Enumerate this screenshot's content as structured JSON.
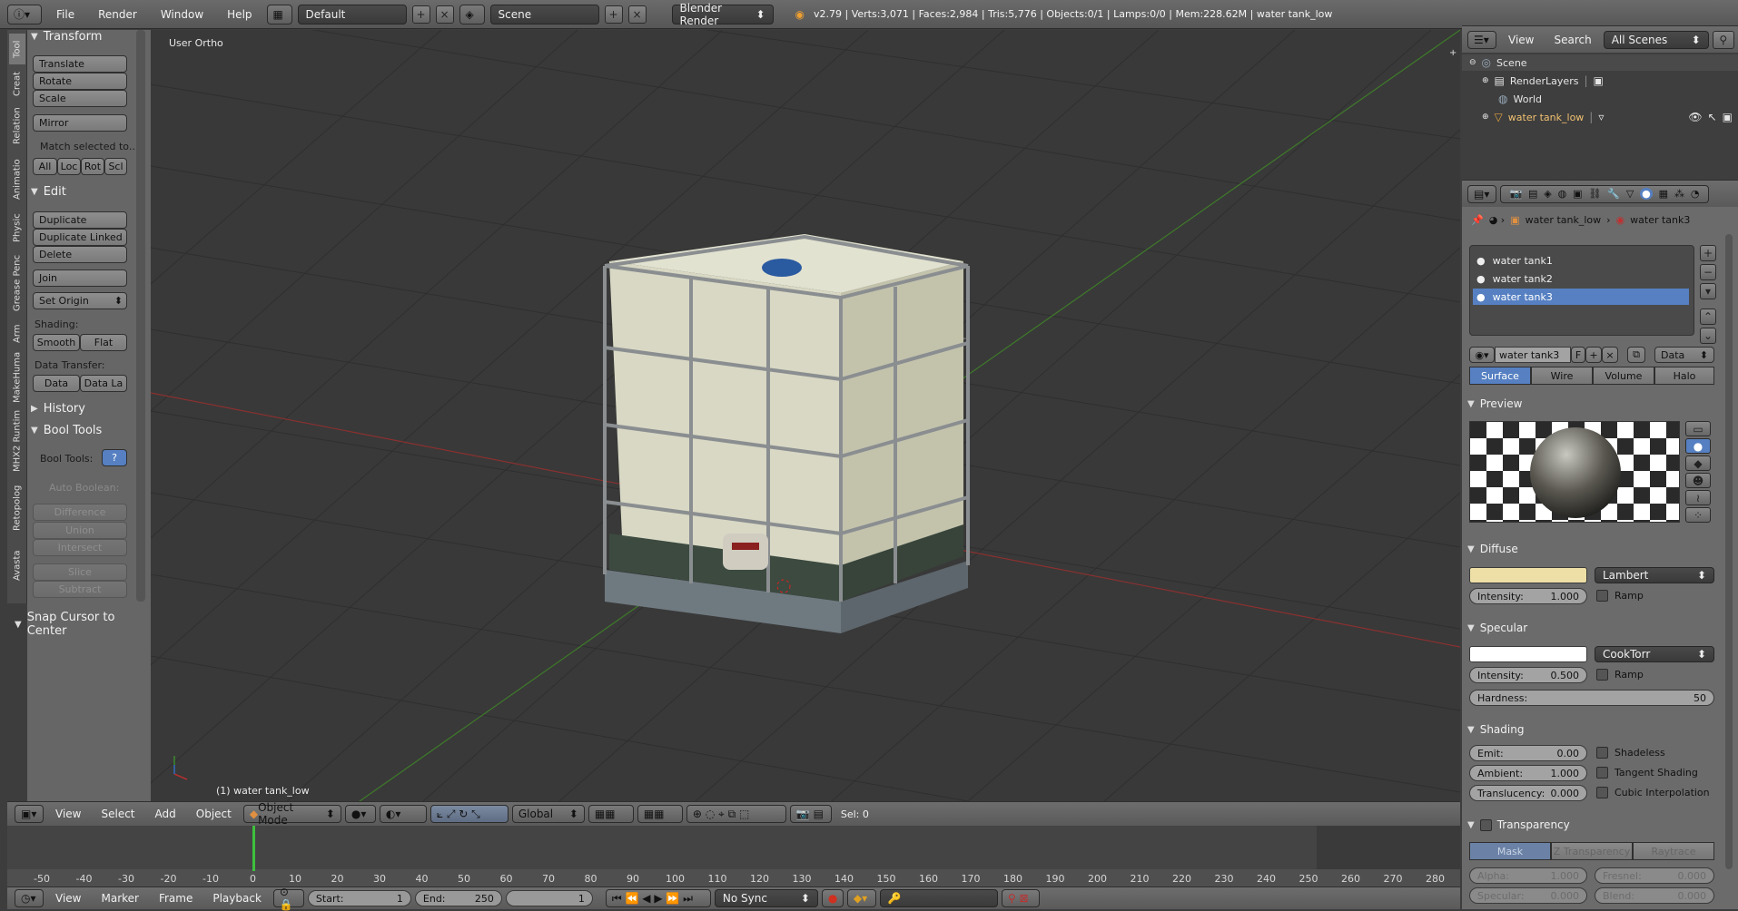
{
  "topbar": {
    "menus": [
      "File",
      "Render",
      "Window",
      "Help"
    ],
    "layout": "Default",
    "scene": "Scene",
    "engine": "Blender Render",
    "stats": "v2.79 | Verts:3,071 | Faces:2,984 | Tris:5,776 | Objects:0/1 | Lamps:0/0 | Mem:228.62M | water tank_low"
  },
  "toolshelf": {
    "vertical_tabs": [
      "Tool",
      "Creat",
      "Relation",
      "Animatio",
      "Physic",
      "Grease Penc",
      "Arm",
      "MakeHuma",
      "MHX2 Runtim",
      "Retopolog",
      "Avasta"
    ],
    "transform": {
      "title": "Transform",
      "translate": "Translate",
      "rotate": "Rotate",
      "scale": "Scale",
      "mirror": "Mirror",
      "match": "Match selected to...",
      "all": "All",
      "loc": "Loc",
      "rot": "Rot",
      "scl": "Scl"
    },
    "edit": {
      "title": "Edit",
      "duplicate": "Duplicate",
      "duplicate_linked": "Duplicate Linked",
      "delete": "Delete",
      "join": "Join",
      "set_origin": "Set Origin",
      "shading_label": "Shading:",
      "smooth": "Smooth",
      "flat": "Flat",
      "data_transfer_label": "Data Transfer:",
      "data": "Data",
      "data_la": "Data La"
    },
    "history": {
      "title": "History"
    },
    "bool_tools": {
      "title": "Bool Tools",
      "label": "Bool Tools:",
      "auto_boolean": "Auto Boolean:",
      "difference": "Difference",
      "union": "Union",
      "intersect": "Intersect",
      "slice": "Slice",
      "subtract": "Subtract"
    },
    "snap": {
      "title": "Snap Cursor to Center"
    }
  },
  "viewport": {
    "view_label": "User Ortho",
    "object_label": "(1) water tank_low"
  },
  "view_header": {
    "menus": [
      "View",
      "Select",
      "Add",
      "Object"
    ],
    "mode": "Object Mode",
    "orientation": "Global",
    "sel": "Sel: 0"
  },
  "timeline": {
    "ticks": [
      "-50",
      "-40",
      "-30",
      "-20",
      "-10",
      "0",
      "10",
      "20",
      "30",
      "40",
      "50",
      "60",
      "70",
      "80",
      "90",
      "100",
      "110",
      "120",
      "130",
      "140",
      "150",
      "160",
      "170",
      "180",
      "190",
      "200",
      "210",
      "220",
      "230",
      "240",
      "250",
      "260",
      "270",
      "280"
    ],
    "current_frame_value": 0,
    "menus": [
      "View",
      "Marker",
      "Frame",
      "Playback"
    ],
    "start_label": "Start:",
    "start": "1",
    "end_label": "End:",
    "end": "250",
    "current": "1",
    "sync": "No Sync"
  },
  "outliner": {
    "menus": [
      "View",
      "Search"
    ],
    "filter": "All Scenes",
    "items": [
      {
        "label": "Scene",
        "indent": 0
      },
      {
        "label": "RenderLayers",
        "indent": 1
      },
      {
        "label": "World",
        "indent": 1
      },
      {
        "label": "water tank_low",
        "indent": 1
      }
    ]
  },
  "properties": {
    "breadcrumb_object": "water tank_low",
    "breadcrumb_material": "water tank3",
    "slots": [
      "water tank1",
      "water tank2",
      "water tank3"
    ],
    "active_slot": 2,
    "material_name": "water tank3",
    "fake_user": "F",
    "link": "Data",
    "tabs": [
      "Surface",
      "Wire",
      "Volume",
      "Halo"
    ],
    "preview_title": "Preview",
    "diffuse": {
      "title": "Diffuse",
      "color": "#eedfa6",
      "shader": "Lambert",
      "intensity_label": "Intensity:",
      "intensity": "1.000",
      "ramp": "Ramp"
    },
    "specular": {
      "title": "Specular",
      "color": "#ffffff",
      "shader": "CookTorr",
      "intensity_label": "Intensity:",
      "intensity": "0.500",
      "ramp": "Ramp",
      "hardness_label": "Hardness:",
      "hardness": "50"
    },
    "shading": {
      "title": "Shading",
      "emit_label": "Emit:",
      "emit": "0.00",
      "ambient_label": "Ambient:",
      "ambient": "1.000",
      "translucency_label": "Translucency:",
      "translucency": "0.000",
      "shadeless": "Shadeless",
      "tangent": "Tangent Shading",
      "cubic": "Cubic Interpolation"
    },
    "transparency": {
      "title": "Transparency",
      "modes": [
        "Mask",
        "Z Transparency",
        "Raytrace"
      ],
      "alpha_label": "Alpha:",
      "alpha": "1.000",
      "fresnel_label": "Fresnel:",
      "fresnel": "0.000",
      "specular_label": "Specular:",
      "specular": "0.000",
      "blend_label": "Blend:",
      "blend": "0.000"
    }
  },
  "colors": {
    "accent": "#5680c2",
    "x_axis": "#b03030",
    "y_axis": "#3a8a2a"
  }
}
